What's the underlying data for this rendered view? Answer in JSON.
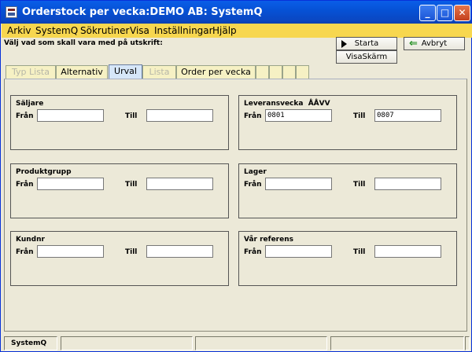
{
  "window": {
    "title": "Orderstock per vecka:DEMO AB: SystemQ",
    "app_icon": "app-icon"
  },
  "title_buttons": {
    "minimize": "_",
    "maximize": "□",
    "close": "✕"
  },
  "menu": [
    "Arkiv",
    "SystemQ",
    "Sökrutiner",
    "Visa",
    "Inställningar",
    "Hjälp"
  ],
  "instruction": "Välj vad som skall vara med på utskrift:",
  "buttons": {
    "start": "Starta",
    "abort": "Avbryt",
    "show_screen": "VisaSkärm"
  },
  "tabs": [
    {
      "label": "Typ Lista",
      "state": "disabled"
    },
    {
      "label": "Alternativ",
      "state": "normal"
    },
    {
      "label": "Urval",
      "state": "active"
    },
    {
      "label": "Lista",
      "state": "disabled"
    },
    {
      "label": "Order per vecka",
      "state": "normal"
    },
    {
      "label": "",
      "state": "normal"
    },
    {
      "label": "",
      "state": "normal"
    },
    {
      "label": "",
      "state": "normal"
    },
    {
      "label": "",
      "state": "normal"
    }
  ],
  "groups": [
    {
      "title": "Säljare",
      "from_label": "Från",
      "to_label": "Till",
      "from_value": "",
      "to_value": ""
    },
    {
      "title": "Leveransvecka  ÅÅVV",
      "from_label": "Från",
      "to_label": "Till",
      "from_value": "0801",
      "to_value": "0807"
    },
    {
      "title": "Produktgrupp",
      "from_label": "Från",
      "to_label": "Till",
      "from_value": "",
      "to_value": ""
    },
    {
      "title": "Lager",
      "from_label": "Från",
      "to_label": "Till",
      "from_value": "",
      "to_value": ""
    },
    {
      "title": "Kundnr",
      "from_label": "Från",
      "to_label": "Till",
      "from_value": "",
      "to_value": ""
    },
    {
      "title": "Vår referens",
      "from_label": "Från",
      "to_label": "Till",
      "from_value": "",
      "to_value": ""
    }
  ],
  "status": [
    "SystemQ",
    "",
    "",
    "",
    ""
  ],
  "colors": {
    "titlebar": "#0a5ee8",
    "menubar": "#f7d74f",
    "tab": "#f6f1c4",
    "tab_active": "#d6e6f8",
    "window_bg": "#ece9d8"
  }
}
